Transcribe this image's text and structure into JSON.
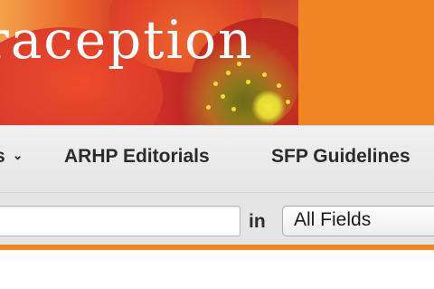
{
  "banner": {
    "title_visible": "raception",
    "accent_color": "#f08522"
  },
  "nav": {
    "items": [
      {
        "label": "s",
        "has_dropdown": true
      },
      {
        "label": "ARHP Editorials",
        "has_dropdown": false
      },
      {
        "label": "SFP Guidelines",
        "has_dropdown": false
      }
    ]
  },
  "search": {
    "query_value": "",
    "in_label": "in",
    "field_selected": "All Fields"
  },
  "icons": {
    "nav_dropdown": "chevron-down-icon"
  }
}
